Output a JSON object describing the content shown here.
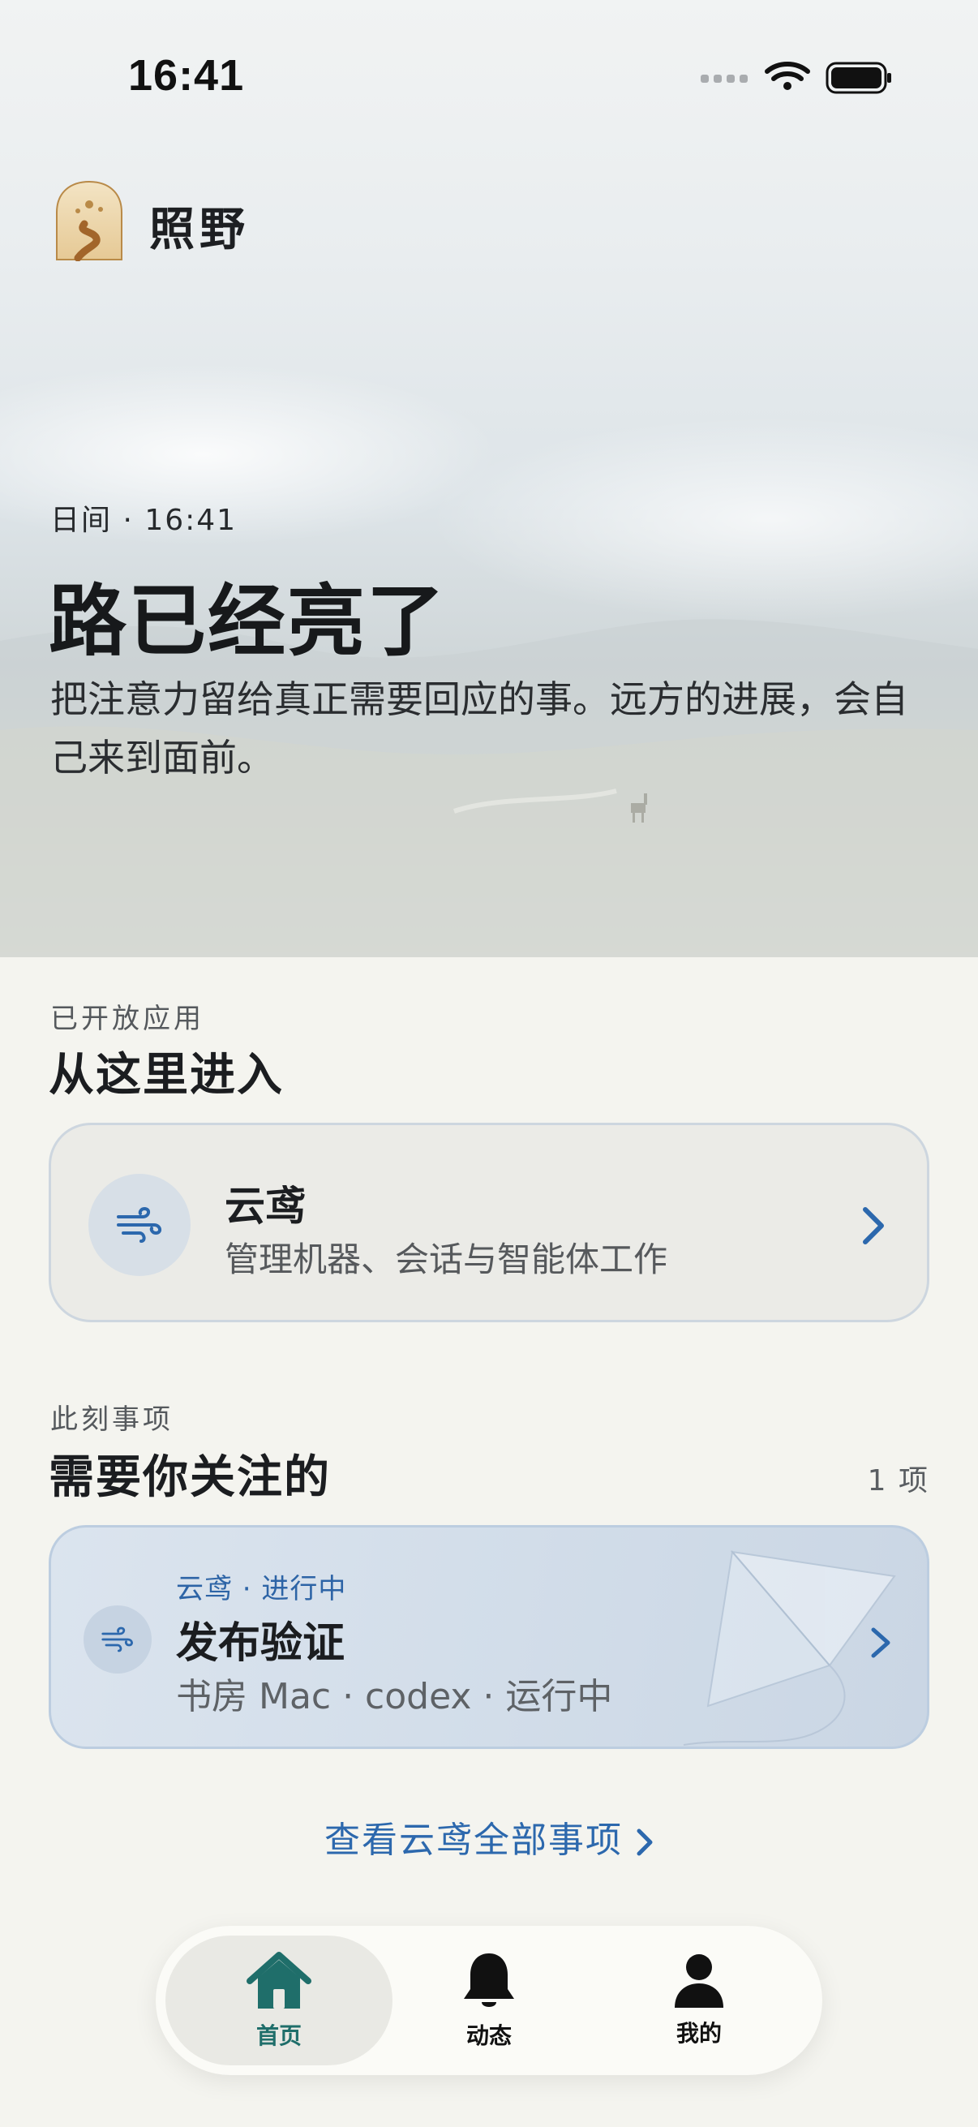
{
  "status_bar": {
    "time": "16:41"
  },
  "header": {
    "app_name": "照野",
    "logo_icon": "lantern-path-logo"
  },
  "hero": {
    "meta": "日间 · 16:41",
    "title": "路已经亮了",
    "description": "把注意力留给真正需要回应的事。远方的进展，会自己来到面前。"
  },
  "apps_section": {
    "eyebrow": "已开放应用",
    "title": "从这里进入",
    "apps": [
      {
        "name": "云鸢",
        "description": "管理机器、会话与智能体工作",
        "icon": "wind-icon"
      }
    ]
  },
  "tasks_section": {
    "eyebrow": "此刻事项",
    "title": "需要你关注的",
    "count": "1 项",
    "items": [
      {
        "tag": "云鸢 · 进行中",
        "title": "发布验证",
        "meta": "书房 Mac · codex · 运行中",
        "icon": "wind-icon"
      }
    ],
    "view_all": "查看云鸢全部事项"
  },
  "tabbar": {
    "tabs": [
      {
        "label": "首页",
        "icon": "home-icon",
        "active": true
      },
      {
        "label": "动态",
        "icon": "bell-icon",
        "active": false
      },
      {
        "label": "我的",
        "icon": "person-icon",
        "active": false
      }
    ]
  },
  "colors": {
    "accent": "#2c68ad",
    "active_tab": "#1f6e6a",
    "background": "#f4f4ef"
  }
}
